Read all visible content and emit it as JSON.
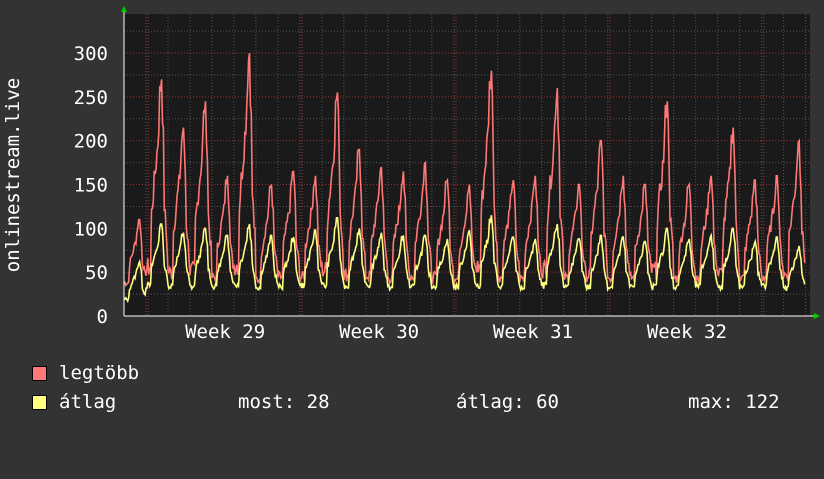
{
  "chart_data": {
    "type": "line",
    "ylabel": "onlinestream.live",
    "ylim": [
      0,
      340
    ],
    "yticks": [
      0,
      50,
      100,
      150,
      200,
      250,
      300
    ],
    "x_labels": [
      "Week 29",
      "Week 30",
      "Week 31",
      "Week 32"
    ],
    "grid": true,
    "legend_placement": "bottom-left",
    "series": [
      {
        "name": "legtöbb",
        "color": "#ff7777",
        "daily_peaks": [
          110,
          270,
          215,
          245,
          160,
          300,
          150,
          165,
          160,
          255,
          190,
          170,
          165,
          175,
          155,
          150,
          280,
          155,
          160,
          260,
          150,
          200,
          160,
          150,
          245,
          150,
          160,
          215,
          155,
          160,
          200
        ]
      },
      {
        "name": "átlag",
        "color": "#ffff80",
        "daily_peaks": [
          62,
          105,
          95,
          100,
          92,
          105,
          92,
          90,
          98,
          112,
          100,
          95,
          92,
          92,
          88,
          98,
          115,
          90,
          88,
          105,
          88,
          92,
          90,
          85,
          100,
          88,
          92,
          100,
          85,
          90,
          80
        ]
      }
    ]
  },
  "legend": [
    {
      "label": "legtöbb",
      "color": "#ff7777"
    },
    {
      "label": "átlag",
      "color": "#ffff80"
    }
  ],
  "stats": {
    "most": "most: 28",
    "atlag": "átlag: 60",
    "max": "max: 122"
  },
  "colors": {
    "background": "#333333",
    "plot_background": "#1a1a1a",
    "grid_major": "#a03030",
    "grid_minor": "#555555",
    "axis": "#ffffff",
    "arrow": "#00cc00"
  }
}
